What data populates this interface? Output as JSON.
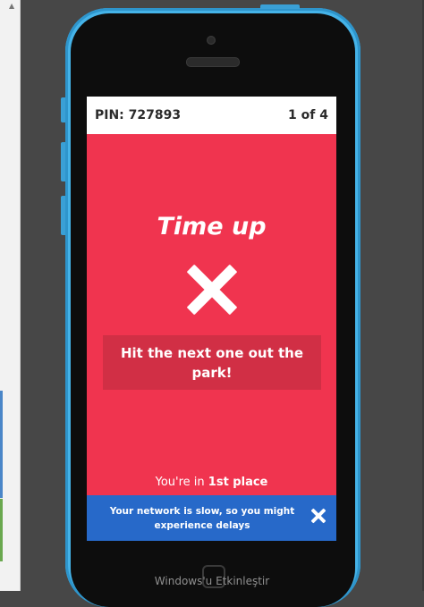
{
  "game": {
    "pin_label": "PIN: 727893",
    "question_progress": "1 of 4",
    "result_title": "Time up",
    "result_icon": "cross-icon",
    "feedback_message": "Hit the next one out the park!",
    "placement_prefix": "You're in",
    "placement_rank": "1st place"
  },
  "network_warning": {
    "message": "Your network is slow, so you might experience delays",
    "close_icon": "close-icon"
  },
  "overlay": {
    "watermark": "Windows'u Etkinleştir"
  },
  "colors": {
    "screen_background": "#f0344f",
    "message_box": "#d12f45",
    "network_bar": "#2769c9",
    "phone_body": "#45b3e8"
  }
}
